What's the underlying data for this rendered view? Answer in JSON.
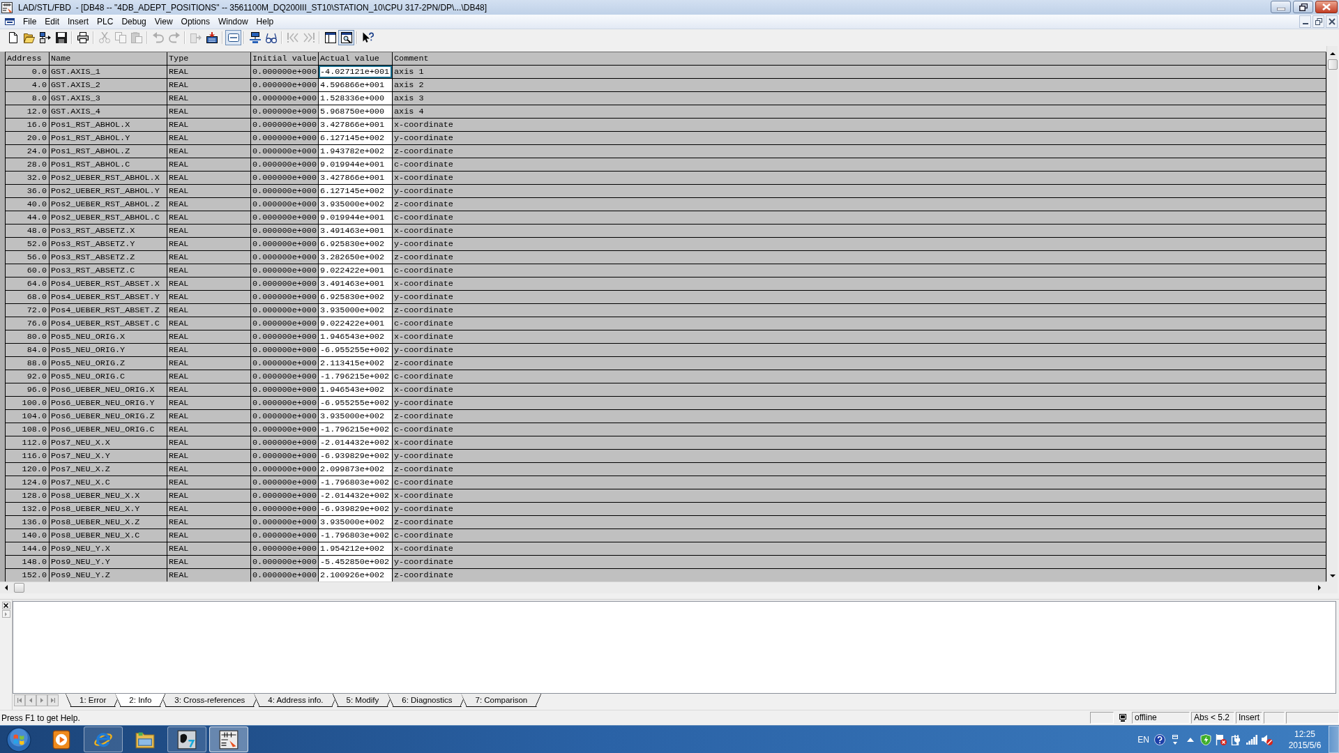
{
  "window": {
    "title": "LAD/STL/FBD  - [DB48 -- \"4DB_ADEPT_POSITIONS\" -- 3561100M_DQ200III_ST10\\STATION_10\\CPU 317-2PN/DP\\...\\DB48]"
  },
  "menu_bar": {
    "items": [
      "File",
      "Edit",
      "Insert",
      "PLC",
      "Debug",
      "View",
      "Options",
      "Window",
      "Help"
    ]
  },
  "toolbar": {
    "groups": [
      [
        {
          "disabled": false,
          "on": false
        },
        {
          "disabled": false,
          "on": false
        },
        {
          "disabled": false,
          "on": false
        },
        {
          "disabled": false,
          "on": false
        }
      ],
      [
        {
          "disabled": false,
          "on": false
        }
      ],
      [
        {
          "disabled": true,
          "on": false
        },
        {
          "disabled": true,
          "on": false
        },
        {
          "disabled": true,
          "on": false
        }
      ],
      [
        {
          "disabled": true,
          "on": false
        },
        {
          "disabled": true,
          "on": false
        }
      ],
      [
        {
          "disabled": true,
          "on": false
        },
        {
          "disabled": false,
          "on": false
        }
      ],
      [
        {
          "disabled": false,
          "on": true
        }
      ],
      [
        {
          "disabled": false,
          "on": false
        },
        {
          "disabled": false,
          "on": false
        }
      ],
      [
        {
          "disabled": true,
          "on": false
        },
        {
          "disabled": true,
          "on": false
        }
      ],
      [
        {
          "disabled": false,
          "on": false
        },
        {
          "disabled": false,
          "on": true
        }
      ],
      [
        {
          "disabled": false,
          "on": false
        }
      ]
    ]
  },
  "table": {
    "columns": [
      "Address",
      "Name",
      "Type",
      "Initial value",
      "Actual value",
      "Comment"
    ],
    "rows": [
      {
        "address": "0.0",
        "name": "GST.AXIS_1",
        "type": "REAL",
        "initial_value": "0.000000e+000",
        "actual_value": "-4.027121e+001",
        "comment": "axis 1",
        "selected": true
      },
      {
        "address": "4.0",
        "name": "GST.AXIS_2",
        "type": "REAL",
        "initial_value": "0.000000e+000",
        "actual_value": "4.596866e+001",
        "comment": "axis 2",
        "selected": false
      },
      {
        "address": "8.0",
        "name": "GST.AXIS_3",
        "type": "REAL",
        "initial_value": "0.000000e+000",
        "actual_value": "1.528336e+000",
        "comment": "axis 3",
        "selected": false
      },
      {
        "address": "12.0",
        "name": "GST.AXIS_4",
        "type": "REAL",
        "initial_value": "0.000000e+000",
        "actual_value": "5.968750e+000",
        "comment": "axis 4",
        "selected": false
      },
      {
        "address": "16.0",
        "name": "Pos1_RST_ABHOL.X",
        "type": "REAL",
        "initial_value": "0.000000e+000",
        "actual_value": "3.427866e+001",
        "comment": "x-coordinate",
        "selected": false
      },
      {
        "address": "20.0",
        "name": "Pos1_RST_ABHOL.Y",
        "type": "REAL",
        "initial_value": "0.000000e+000",
        "actual_value": "6.127145e+002",
        "comment": "y-coordinate",
        "selected": false
      },
      {
        "address": "24.0",
        "name": "Pos1_RST_ABHOL.Z",
        "type": "REAL",
        "initial_value": "0.000000e+000",
        "actual_value": "1.943782e+002",
        "comment": "z-coordinate",
        "selected": false
      },
      {
        "address": "28.0",
        "name": "Pos1_RST_ABHOL.C",
        "type": "REAL",
        "initial_value": "0.000000e+000",
        "actual_value": "9.019944e+001",
        "comment": "c-coordinate",
        "selected": false
      },
      {
        "address": "32.0",
        "name": "Pos2_UEBER_RST_ABHOL.X",
        "type": "REAL",
        "initial_value": "0.000000e+000",
        "actual_value": "3.427866e+001",
        "comment": "x-coordinate",
        "selected": false
      },
      {
        "address": "36.0",
        "name": "Pos2_UEBER_RST_ABHOL.Y",
        "type": "REAL",
        "initial_value": "0.000000e+000",
        "actual_value": "6.127145e+002",
        "comment": "y-coordinate",
        "selected": false
      },
      {
        "address": "40.0",
        "name": "Pos2_UEBER_RST_ABHOL.Z",
        "type": "REAL",
        "initial_value": "0.000000e+000",
        "actual_value": "3.935000e+002",
        "comment": "z-coordinate",
        "selected": false
      },
      {
        "address": "44.0",
        "name": "Pos2_UEBER_RST_ABHOL.C",
        "type": "REAL",
        "initial_value": "0.000000e+000",
        "actual_value": "9.019944e+001",
        "comment": "c-coordinate",
        "selected": false
      },
      {
        "address": "48.0",
        "name": "Pos3_RST_ABSETZ.X",
        "type": "REAL",
        "initial_value": "0.000000e+000",
        "actual_value": "3.491463e+001",
        "comment": "x-coordinate",
        "selected": false
      },
      {
        "address": "52.0",
        "name": "Pos3_RST_ABSETZ.Y",
        "type": "REAL",
        "initial_value": "0.000000e+000",
        "actual_value": "6.925830e+002",
        "comment": "y-coordinate",
        "selected": false
      },
      {
        "address": "56.0",
        "name": "Pos3_RST_ABSETZ.Z",
        "type": "REAL",
        "initial_value": "0.000000e+000",
        "actual_value": "3.282650e+002",
        "comment": "z-coordinate",
        "selected": false
      },
      {
        "address": "60.0",
        "name": "Pos3_RST_ABSETZ.C",
        "type": "REAL",
        "initial_value": "0.000000e+000",
        "actual_value": "9.022422e+001",
        "comment": "c-coordinate",
        "selected": false
      },
      {
        "address": "64.0",
        "name": "Pos4_UEBER_RST_ABSET.X",
        "type": "REAL",
        "initial_value": "0.000000e+000",
        "actual_value": "3.491463e+001",
        "comment": "x-coordinate",
        "selected": false
      },
      {
        "address": "68.0",
        "name": "Pos4_UEBER_RST_ABSET.Y",
        "type": "REAL",
        "initial_value": "0.000000e+000",
        "actual_value": "6.925830e+002",
        "comment": "y-coordinate",
        "selected": false
      },
      {
        "address": "72.0",
        "name": "Pos4_UEBER_RST_ABSET.Z",
        "type": "REAL",
        "initial_value": "0.000000e+000",
        "actual_value": "3.935000e+002",
        "comment": "z-coordinate",
        "selected": false
      },
      {
        "address": "76.0",
        "name": "Pos4_UEBER_RST_ABSET.C",
        "type": "REAL",
        "initial_value": "0.000000e+000",
        "actual_value": "9.022422e+001",
        "comment": "c-coordinate",
        "selected": false
      },
      {
        "address": "80.0",
        "name": "Pos5_NEU_ORIG.X",
        "type": "REAL",
        "initial_value": "0.000000e+000",
        "actual_value": "1.946543e+002",
        "comment": "x-coordinate",
        "selected": false
      },
      {
        "address": "84.0",
        "name": "Pos5_NEU_ORIG.Y",
        "type": "REAL",
        "initial_value": "0.000000e+000",
        "actual_value": "-6.955255e+002",
        "comment": "y-coordinate",
        "selected": false
      },
      {
        "address": "88.0",
        "name": "Pos5_NEU_ORIG.Z",
        "type": "REAL",
        "initial_value": "0.000000e+000",
        "actual_value": "2.113415e+002",
        "comment": "z-coordinate",
        "selected": false
      },
      {
        "address": "92.0",
        "name": "Pos5_NEU_ORIG.C",
        "type": "REAL",
        "initial_value": "0.000000e+000",
        "actual_value": "-1.796215e+002",
        "comment": "c-coordinate",
        "selected": false
      },
      {
        "address": "96.0",
        "name": "Pos6_UEBER_NEU_ORIG.X",
        "type": "REAL",
        "initial_value": "0.000000e+000",
        "actual_value": "1.946543e+002",
        "comment": "x-coordinate",
        "selected": false
      },
      {
        "address": "100.0",
        "name": "Pos6_UEBER_NEU_ORIG.Y",
        "type": "REAL",
        "initial_value": "0.000000e+000",
        "actual_value": "-6.955255e+002",
        "comment": "y-coordinate",
        "selected": false
      },
      {
        "address": "104.0",
        "name": "Pos6_UEBER_NEU_ORIG.Z",
        "type": "REAL",
        "initial_value": "0.000000e+000",
        "actual_value": "3.935000e+002",
        "comment": "z-coordinate",
        "selected": false
      },
      {
        "address": "108.0",
        "name": "Pos6_UEBER_NEU_ORIG.C",
        "type": "REAL",
        "initial_value": "0.000000e+000",
        "actual_value": "-1.796215e+002",
        "comment": "c-coordinate",
        "selected": false
      },
      {
        "address": "112.0",
        "name": "Pos7_NEU_X.X",
        "type": "REAL",
        "initial_value": "0.000000e+000",
        "actual_value": "-2.014432e+002",
        "comment": "x-coordinate",
        "selected": false
      },
      {
        "address": "116.0",
        "name": "Pos7_NEU_X.Y",
        "type": "REAL",
        "initial_value": "0.000000e+000",
        "actual_value": "-6.939829e+002",
        "comment": "y-coordinate",
        "selected": false
      },
      {
        "address": "120.0",
        "name": "Pos7_NEU_X.Z",
        "type": "REAL",
        "initial_value": "0.000000e+000",
        "actual_value": "2.099873e+002",
        "comment": "z-coordinate",
        "selected": false
      },
      {
        "address": "124.0",
        "name": "Pos7_NEU_X.C",
        "type": "REAL",
        "initial_value": "0.000000e+000",
        "actual_value": "-1.796803e+002",
        "comment": "c-coordinate",
        "selected": false
      },
      {
        "address": "128.0",
        "name": "Pos8_UEBER_NEU_X.X",
        "type": "REAL",
        "initial_value": "0.000000e+000",
        "actual_value": "-2.014432e+002",
        "comment": "x-coordinate",
        "selected": false
      },
      {
        "address": "132.0",
        "name": "Pos8_UEBER_NEU_X.Y",
        "type": "REAL",
        "initial_value": "0.000000e+000",
        "actual_value": "-6.939829e+002",
        "comment": "y-coordinate",
        "selected": false
      },
      {
        "address": "136.0",
        "name": "Pos8_UEBER_NEU_X.Z",
        "type": "REAL",
        "initial_value": "0.000000e+000",
        "actual_value": "3.935000e+002",
        "comment": "z-coordinate",
        "selected": false
      },
      {
        "address": "140.0",
        "name": "Pos8_UEBER_NEU_X.C",
        "type": "REAL",
        "initial_value": "0.000000e+000",
        "actual_value": "-1.796803e+002",
        "comment": "c-coordinate",
        "selected": false
      },
      {
        "address": "144.0",
        "name": "Pos9_NEU_Y.X",
        "type": "REAL",
        "initial_value": "0.000000e+000",
        "actual_value": "1.954212e+002",
        "comment": "x-coordinate",
        "selected": false
      },
      {
        "address": "148.0",
        "name": "Pos9_NEU_Y.Y",
        "type": "REAL",
        "initial_value": "0.000000e+000",
        "actual_value": "-5.452850e+002",
        "comment": "y-coordinate",
        "selected": false
      },
      {
        "address": "152.0",
        "name": "Pos9_NEU_Y.Z",
        "type": "REAL",
        "initial_value": "0.000000e+000",
        "actual_value": "2.100926e+002",
        "comment": "z-coordinate",
        "selected": false
      }
    ]
  },
  "output_panel": {
    "tabs": [
      {
        "label": "1: Error",
        "selected": false
      },
      {
        "label": "2: Info",
        "selected": true
      },
      {
        "label": "3: Cross-references",
        "selected": false
      },
      {
        "label": "4: Address info.",
        "selected": false
      },
      {
        "label": "5: Modify",
        "selected": false
      },
      {
        "label": "6: Diagnostics",
        "selected": false
      },
      {
        "label": "7: Comparison",
        "selected": false
      }
    ]
  },
  "status_bar": {
    "message": "Press F1 to get Help.",
    "panes": [
      "offline",
      "Abs < 5.2",
      "Insert"
    ]
  },
  "taskbar": {
    "apps": [
      {
        "running": false,
        "selected": false
      },
      {
        "running": true,
        "selected": false
      },
      {
        "running": false,
        "selected": false
      },
      {
        "running": true,
        "selected": false
      },
      {
        "running": true,
        "selected": true
      }
    ],
    "tray": {
      "language": "EN",
      "time": "12:25",
      "date": "2015/5/6"
    }
  }
}
